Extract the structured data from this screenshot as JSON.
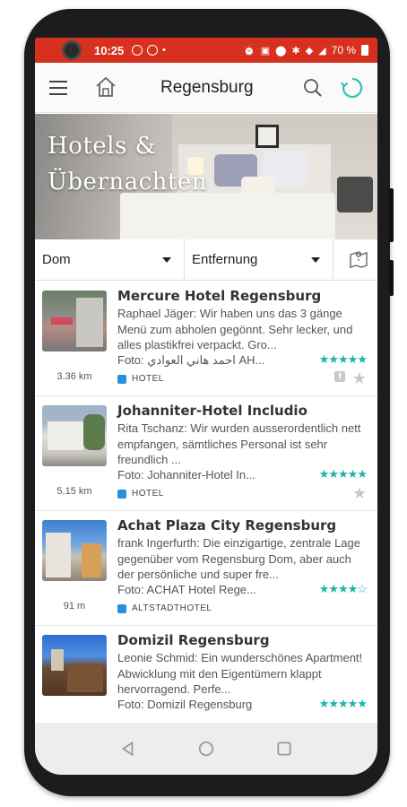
{
  "status": {
    "time": "10:25",
    "battery": "70 %"
  },
  "appbar": {
    "title": "Regensburg",
    "icons": [
      "menu-icon",
      "home-icon",
      "search-icon",
      "refresh-icon"
    ],
    "accent": "#2ec4b6"
  },
  "hero": {
    "title_line1": "Hotels &",
    "title_line2": "Übernachten"
  },
  "filters": {
    "location": "Dom",
    "sort": "Entfernung"
  },
  "colors": {
    "statusbar": "#d7301f",
    "stars": "#19b5a6",
    "category": "#2a8fd8"
  },
  "items": [
    {
      "name": "Mercure Hotel Regensburg",
      "review": "Raphael Jäger: Wir haben uns das 3 gänge Menü zum abholen gegönnt. Sehr lecker, und alles plastikfrei verpackt. Gro...",
      "foto": "Foto: احمد هاني العوادي AH...",
      "stars": "★★★★★",
      "rating": 5,
      "distance": "3.36 km",
      "category": "HOTEL"
    },
    {
      "name": "Johanniter-Hotel Includio",
      "review": "Rita Tschanz: Wir wurden ausserordentlich nett empfangen, sämtliches Personal ist sehr freundlich ...",
      "foto": "Foto: Johanniter-Hotel In...",
      "stars": "★★★★★",
      "rating": 5,
      "distance": "5.15 km",
      "category": "HOTEL"
    },
    {
      "name": "Achat Plaza City Regensburg",
      "review": "frank Ingerfurth: Die einzigartige, zentrale Lage gegenüber vom Regensburg Dom, aber auch der persönliche und super fre...",
      "foto": "Foto: ACHAT Hotel Rege...",
      "stars": "★★★★☆",
      "rating": 4,
      "distance": "91 m",
      "category": "ALTSTADTHOTEL"
    },
    {
      "name": "Domizil Regensburg",
      "review": "Leonie Schmid: Ein wunderschönes Apartment! Abwicklung mit den Eigentümern klappt hervorragend. Perfe...",
      "foto": "Foto: Domizil Regensburg",
      "stars": "★★★★★",
      "rating": 5,
      "distance": "",
      "category": ""
    }
  ]
}
